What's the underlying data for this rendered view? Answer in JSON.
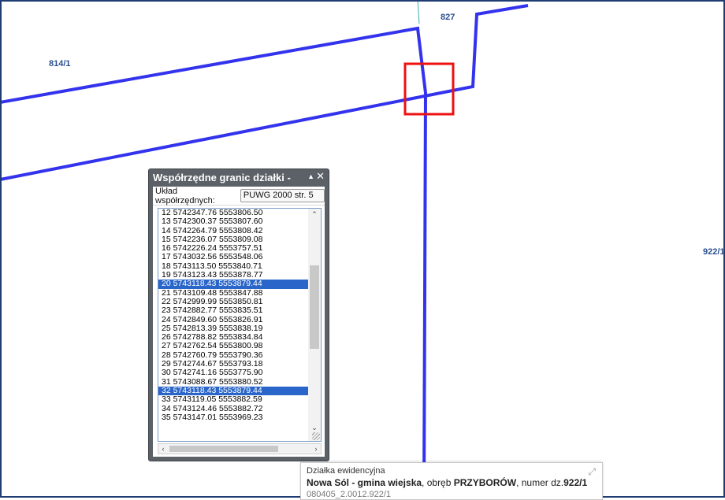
{
  "map": {
    "parcel_labels": [
      "827",
      "814/1",
      "922/1"
    ],
    "colors": {
      "parcel_boundary": "#3333ee",
      "highlight_box": "#ee1111",
      "thin_line": "#39b0b8",
      "frame": "#1f3d73"
    }
  },
  "coord_panel": {
    "title": "Współrzędne granic działki -",
    "system_label": "Układ współrzędnych:",
    "system_value": "PUWG 2000 str. 5",
    "collapse_icon": "triangle-up-icon",
    "close_icon": "close-icon",
    "rows": [
      "12 5742347.76 5553806.50",
      "13 5742300.37 5553807.60",
      "14 5742264.79 5553808.42",
      "15 5742236.07 5553809.08",
      "16 5742226.24 5553757.51",
      "17 5743032.56 5553548.06",
      "18 5743113.50 5553840.71",
      "19 5743123.43 5553878.77",
      "20 5743118.43 5553879.44",
      "21 5743109.48 5553847.88",
      "22 5742999.99 5553850.81",
      "23 5742882.77 5553835.51",
      "24 5742849.60 5553826.91",
      "25 5742813.39 5553838.19",
      "26 5742788.82 5553834.84",
      "27 5742762.54 5553800.98",
      "28 5742760.79 5553790.36",
      "29 5742744.67 5553793.18",
      "30 5742741.16 5553775.90",
      "31 5743088.67 5553880.52",
      "32 5743118.43 5553879.44",
      "33 5743119.05 5553882.59",
      "34 5743124.46 5553882.72",
      "35 5743147.01 5553969.23"
    ],
    "selected_rows": [
      "20 5743118.43 5553879.44",
      "32 5743118.43 5553879.44"
    ]
  },
  "info_popup": {
    "kind": "Działka ewidencyjna",
    "municipality": "Nowa Sól - gmina wiejska",
    "precinct_prefix": ", obręb ",
    "precinct": "PRZYBORÓW",
    "number_prefix": ", numer dz.",
    "number": "922/1",
    "code": "080405_2.0012.922/1"
  }
}
